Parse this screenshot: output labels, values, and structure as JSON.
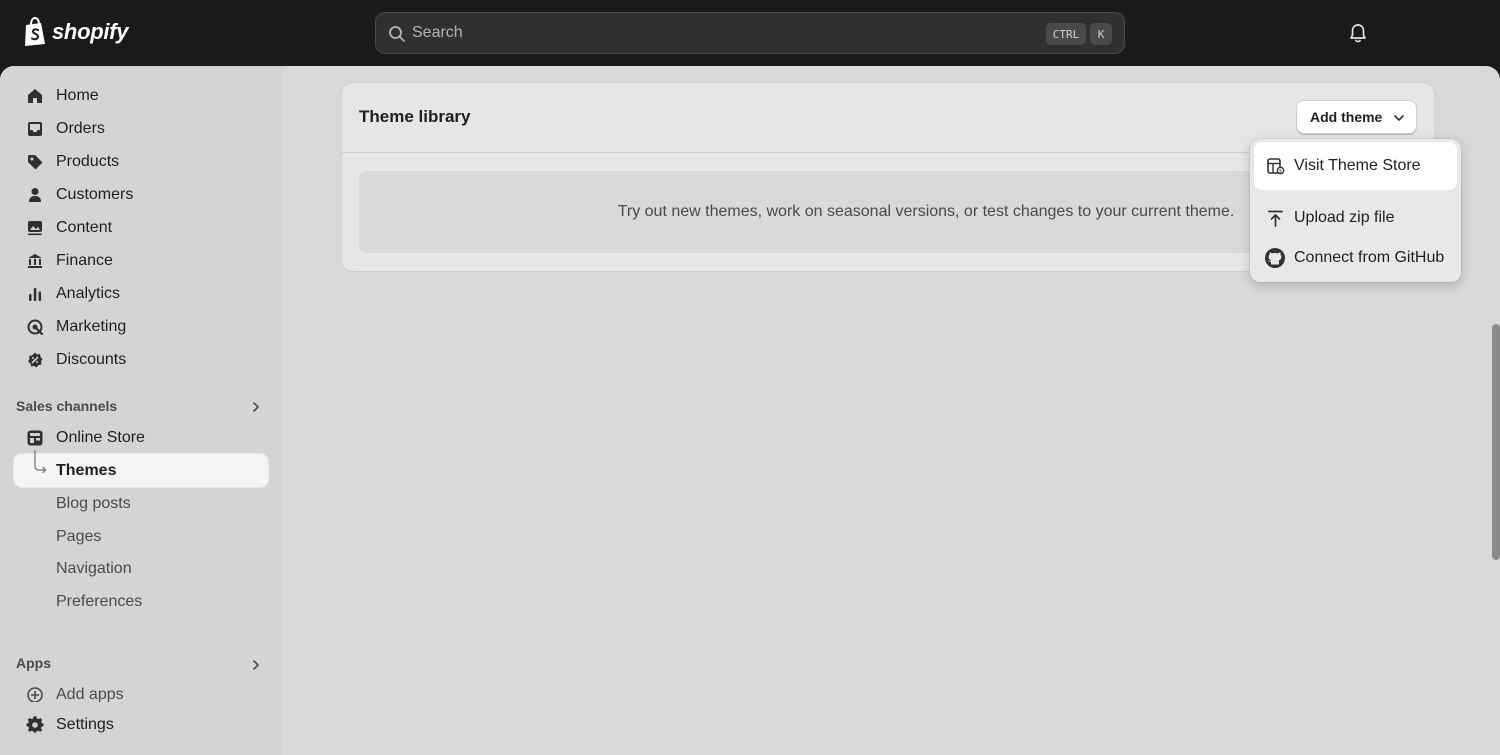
{
  "brand": {
    "name": "shopify"
  },
  "search": {
    "placeholder": "Search",
    "shortcut_ctrl": "CTRL",
    "shortcut_key": "K"
  },
  "sidebar": {
    "items": [
      {
        "label": "Home",
        "icon": "home-icon"
      },
      {
        "label": "Orders",
        "icon": "inbox-icon"
      },
      {
        "label": "Products",
        "icon": "tag-icon"
      },
      {
        "label": "Customers",
        "icon": "person-icon"
      },
      {
        "label": "Content",
        "icon": "image-icon"
      },
      {
        "label": "Finance",
        "icon": "bank-icon"
      },
      {
        "label": "Analytics",
        "icon": "bar-chart-icon"
      },
      {
        "label": "Marketing",
        "icon": "target-icon"
      },
      {
        "label": "Discounts",
        "icon": "discount-icon"
      }
    ],
    "sales_channels_title": "Sales channels",
    "online_store": {
      "label": "Online Store",
      "icon": "store-icon"
    },
    "online_store_subitems": [
      {
        "label": "Themes",
        "active": true
      },
      {
        "label": "Blog posts"
      },
      {
        "label": "Pages"
      },
      {
        "label": "Navigation"
      },
      {
        "label": "Preferences"
      }
    ],
    "apps_title": "Apps",
    "add_apps": "Add apps",
    "settings": "Settings"
  },
  "theme_library": {
    "title": "Theme library",
    "add_theme_label": "Add theme",
    "empty_message": "Try out new themes, work on seasonal versions, or test changes to your current theme."
  },
  "add_theme_menu": {
    "items": [
      {
        "label": "Visit Theme Store",
        "icon": "theme-store-icon"
      },
      {
        "label": "Upload zip file",
        "icon": "upload-icon"
      },
      {
        "label": "Connect from GitHub",
        "icon": "github-icon"
      }
    ]
  },
  "colors": {
    "topbar": "#1a1a1a",
    "frame": "#d9d9d9",
    "sidebar": "#d4d4d4",
    "card": "#e6e6e6",
    "text": "#1f1f1f"
  }
}
